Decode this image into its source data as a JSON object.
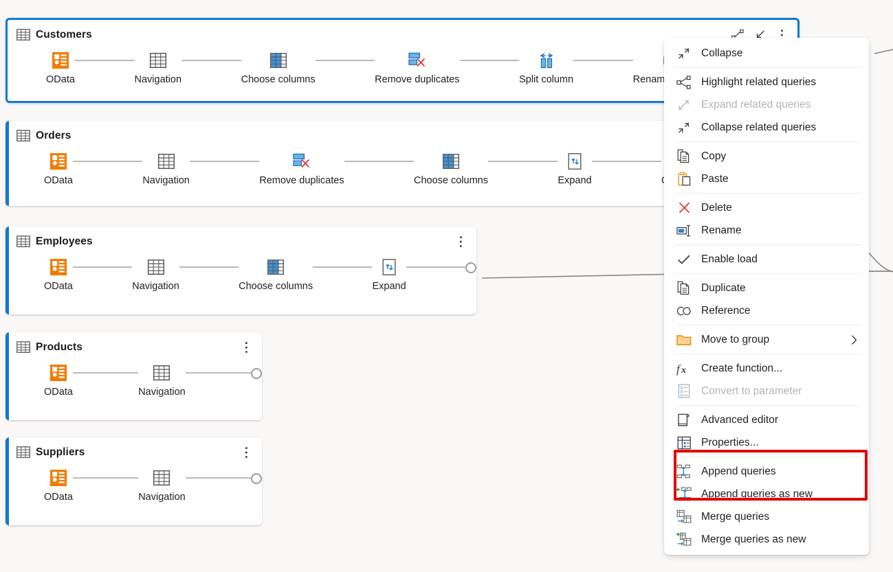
{
  "app": {
    "view": "Power Query diagram view",
    "background_color": "#f9f8f7",
    "accent_color": "#0f78d4",
    "highlight_color": "#e60000"
  },
  "queries": [
    {
      "name": "Customers",
      "selected": true,
      "steps": [
        "OData",
        "Navigation",
        "Choose columns",
        "Remove duplicates",
        "Split column",
        "Rename columns"
      ],
      "step_icons": [
        "odata-icon",
        "navigation-table-icon",
        "choose-columns-icon",
        "remove-duplicates-icon",
        "split-column-icon",
        "rename-columns-icon"
      ],
      "tools": [
        "highlight-related-queries-icon",
        "collapse-icon",
        "more-options-icon"
      ],
      "has_endpoint": false
    },
    {
      "name": "Orders",
      "selected": false,
      "steps": [
        "OData",
        "Navigation",
        "Remove duplicates",
        "Choose columns",
        "Expand",
        "Group by"
      ],
      "step_icons": [
        "odata-icon",
        "navigation-table-icon",
        "remove-duplicates-icon",
        "choose-columns-icon",
        "expand-icon",
        "group-by-icon"
      ],
      "tools": [],
      "has_endpoint": false
    },
    {
      "name": "Employees",
      "selected": false,
      "steps": [
        "OData",
        "Navigation",
        "Choose columns",
        "Expand"
      ],
      "step_icons": [
        "odata-icon",
        "navigation-table-icon",
        "choose-columns-icon",
        "expand-icon"
      ],
      "tools": [
        "more-options-icon"
      ],
      "has_endpoint": true
    },
    {
      "name": "Products",
      "selected": false,
      "steps": [
        "OData",
        "Navigation"
      ],
      "step_icons": [
        "odata-icon",
        "navigation-table-icon"
      ],
      "tools": [
        "more-options-icon"
      ],
      "has_endpoint": true
    },
    {
      "name": "Suppliers",
      "selected": false,
      "steps": [
        "OData",
        "Navigation"
      ],
      "step_icons": [
        "odata-icon",
        "navigation-table-icon"
      ],
      "tools": [
        "more-options-icon"
      ],
      "has_endpoint": true
    }
  ],
  "context_menu": {
    "items": [
      {
        "label": "Collapse",
        "icon": "collapse-icon",
        "disabled": false,
        "submenu": false,
        "checked": false
      },
      {
        "separator": true
      },
      {
        "label": "Highlight related queries",
        "icon": "highlight-related-icon",
        "disabled": false,
        "submenu": false,
        "checked": false
      },
      {
        "label": "Expand related queries",
        "icon": "expand-related-icon",
        "disabled": true,
        "submenu": false,
        "checked": false
      },
      {
        "label": "Collapse related queries",
        "icon": "collapse-related-icon",
        "disabled": false,
        "submenu": false,
        "checked": false
      },
      {
        "separator": true
      },
      {
        "label": "Copy",
        "icon": "copy-icon",
        "disabled": false,
        "submenu": false,
        "checked": false
      },
      {
        "label": "Paste",
        "icon": "paste-icon",
        "disabled": false,
        "submenu": false,
        "checked": false
      },
      {
        "separator": true
      },
      {
        "label": "Delete",
        "icon": "delete-x-icon",
        "disabled": false,
        "submenu": false,
        "checked": false
      },
      {
        "label": "Rename",
        "icon": "rename-icon",
        "disabled": false,
        "submenu": false,
        "checked": false
      },
      {
        "separator": true
      },
      {
        "label": "Enable load",
        "icon": "checkmark-icon",
        "disabled": false,
        "submenu": false,
        "checked": true
      },
      {
        "separator": true
      },
      {
        "label": "Duplicate",
        "icon": "duplicate-icon",
        "disabled": false,
        "submenu": false,
        "checked": false
      },
      {
        "label": "Reference",
        "icon": "reference-link-icon",
        "disabled": false,
        "submenu": false,
        "checked": false
      },
      {
        "separator": true
      },
      {
        "label": "Move to group",
        "icon": "folder-icon",
        "disabled": false,
        "submenu": true,
        "checked": false
      },
      {
        "separator": true
      },
      {
        "label": "Create function...",
        "icon": "fx-icon",
        "disabled": false,
        "submenu": false,
        "checked": false
      },
      {
        "label": "Convert to parameter",
        "icon": "parameter-icon",
        "disabled": true,
        "submenu": false,
        "checked": false
      },
      {
        "separator": true
      },
      {
        "label": "Advanced editor",
        "icon": "advanced-editor-icon",
        "disabled": false,
        "submenu": false,
        "checked": false
      },
      {
        "label": "Properties...",
        "icon": "properties-icon",
        "disabled": false,
        "submenu": false,
        "checked": false
      },
      {
        "separator": true
      },
      {
        "label": "Append queries",
        "icon": "append-queries-icon",
        "disabled": false,
        "submenu": false,
        "checked": false
      },
      {
        "label": "Append queries as new",
        "icon": "append-queries-as-new-icon",
        "disabled": false,
        "submenu": false,
        "checked": false
      },
      {
        "separator": false,
        "spacer": true
      },
      {
        "label": "Merge queries",
        "icon": "merge-queries-icon",
        "disabled": false,
        "submenu": false,
        "checked": false
      },
      {
        "label": "Merge queries as new",
        "icon": "merge-queries-as-new-icon",
        "disabled": false,
        "submenu": false,
        "checked": false
      }
    ],
    "highlighted_items": [
      "Append queries",
      "Append queries as new"
    ]
  }
}
